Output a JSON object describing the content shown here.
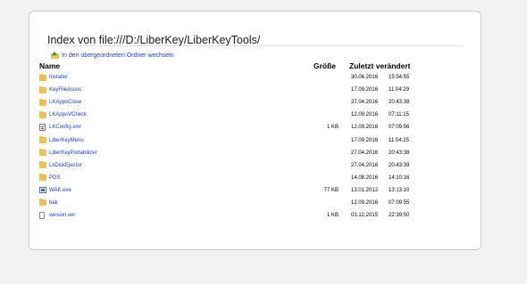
{
  "page": {
    "title": "Index von file:///D:/LiberKey/LiberKeyTools/",
    "up_link": "In den übergeordneten Ordner wechseln"
  },
  "columns": {
    "name": "Name",
    "size": "Größe",
    "modified": "Zuletzt verändert"
  },
  "rows": [
    {
      "name": "Installer",
      "type": "folder-icon",
      "size": "",
      "date": "30.06.2016",
      "time": "15:54:55"
    },
    {
      "name": "KeyFileAssoc",
      "type": "folder-icon",
      "size": "",
      "date": "17.09.2016",
      "time": "11:04:29"
    },
    {
      "name": "LKAppsClose",
      "type": "folder-icon",
      "size": "",
      "date": "27.04.2016",
      "time": "20:43:38"
    },
    {
      "name": "LKAppsVCheck",
      "type": "folder-icon",
      "size": "",
      "date": "12.09.2016",
      "time": "07:11:15"
    },
    {
      "name": "LKConfig.xml",
      "type": "xml-file-icon",
      "size": "1 KB",
      "date": "12.09.2016",
      "time": "07:09:56"
    },
    {
      "name": "LiberKeyMenu",
      "type": "folder-icon",
      "size": "",
      "date": "17.09.2016",
      "time": "11:04:25"
    },
    {
      "name": "LiberKeyPortabilizer",
      "type": "folder-icon",
      "size": "",
      "date": "27.04.2016",
      "time": "20:43:38"
    },
    {
      "name": "LkDiskEjector",
      "type": "folder-icon",
      "size": "",
      "date": "27.04.2016",
      "time": "20:43:39"
    },
    {
      "name": "PDS",
      "type": "folder-icon",
      "size": "",
      "date": "14.08.2016",
      "time": "14:10:16"
    },
    {
      "name": "WAK.exe",
      "type": "exe-file-icon",
      "size": "77 KB",
      "date": "13.01.2012",
      "time": "13:13:10"
    },
    {
      "name": "bak",
      "type": "folder-icon",
      "size": "",
      "date": "12.09.2016",
      "time": "07:09:55"
    },
    {
      "name": "version.ver",
      "type": "file-icon",
      "size": "1 KB",
      "date": "03.12.2015",
      "time": "22:39:50"
    }
  ],
  "colors": {
    "link": "#1a3bd6",
    "folder": "#e8c158",
    "background": "#f2f2f2"
  }
}
